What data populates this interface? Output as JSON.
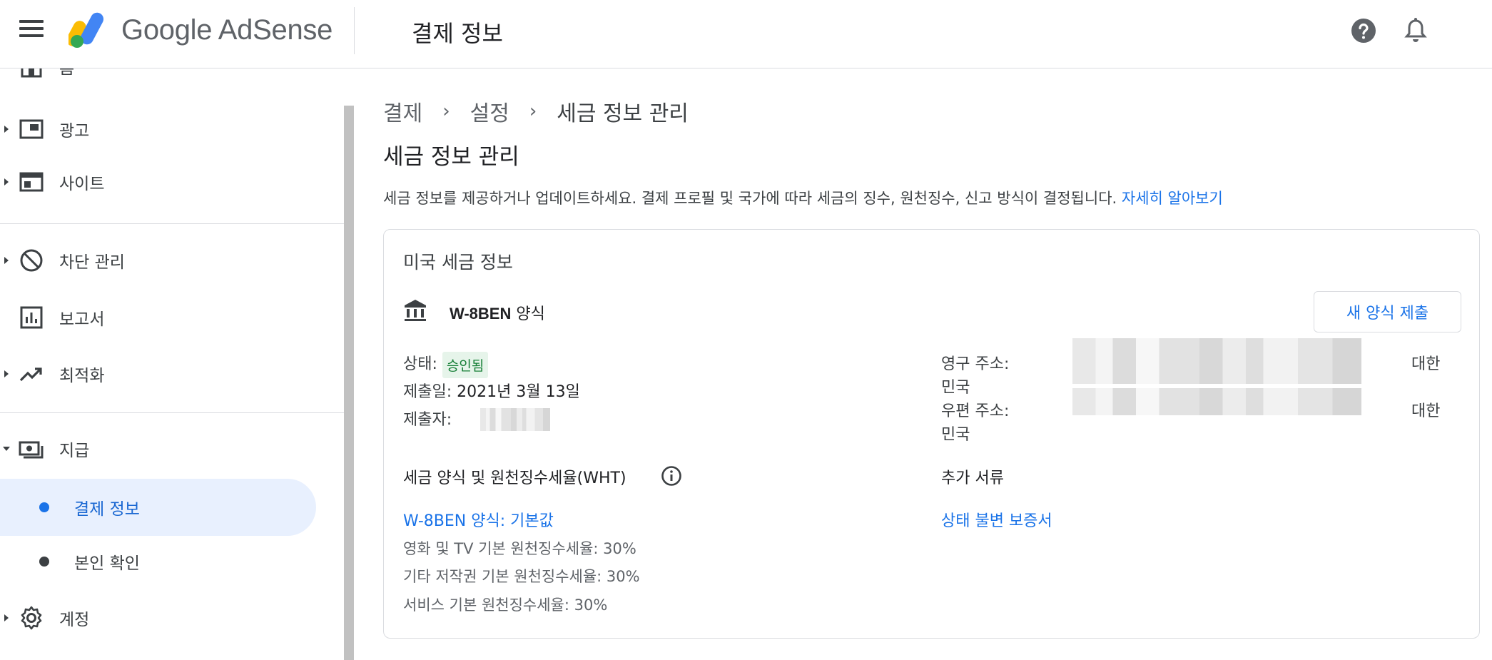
{
  "header": {
    "brand": "Google AdSense",
    "title": "결제 정보"
  },
  "sidebar": {
    "items": [
      {
        "label": "홈",
        "icon": "home-icon"
      },
      {
        "label": "광고",
        "icon": "ads-icon"
      },
      {
        "label": "사이트",
        "icon": "sites-icon"
      },
      {
        "label": "차단 관리",
        "icon": "block-icon"
      },
      {
        "label": "보고서",
        "icon": "reports-icon"
      },
      {
        "label": "최적화",
        "icon": "trending-icon"
      },
      {
        "label": "지급",
        "icon": "payments-icon"
      },
      {
        "label": "결제 정보",
        "icon": "dot"
      },
      {
        "label": "본인 확인",
        "icon": "dot"
      },
      {
        "label": "계정",
        "icon": "gear-icon"
      }
    ]
  },
  "breadcrumb": [
    "결제",
    "설정",
    "세금 정보 관리"
  ],
  "section": {
    "title": "세금 정보 관리",
    "description": "세금 정보를 제공하거나 업데이트하세요. 결제 프로필 및 국가에 따라 세금의 징수, 원천징수, 신고 방식이 결정됩니다.",
    "learn_more": "자세히 알아보기"
  },
  "card": {
    "title": "미국 세금 정보",
    "form_name_bold": "W-8BEN",
    "form_name_suffix": " 양식",
    "submit_button": "새 양식 제출",
    "status_label": "상태:",
    "status_value": "승인됨",
    "submitted_date_label": "제출일:",
    "submitted_date_value": "2021년 3월 13일",
    "submitter_label": "제출자:",
    "permanent_address_label": "영구 주소:",
    "permanent_address_country_1": "대한",
    "permanent_address_country_2": "민국",
    "mailing_address_label": "우편 주소:",
    "mailing_address_country_1": "대한",
    "mailing_address_country_2": "민국",
    "wht_label": "세금 양식 및 원천징수세율(WHT)",
    "additional_docs_label": "추가 서류",
    "form_link": "W-8BEN 양식: 기본값",
    "certificate_link": "상태 불변 보증서",
    "rates": [
      "영화 및 TV 기본 원천징수세율: 30%",
      "기타 저작권 기본 원천징수세율: 30%",
      "서비스 기본 원천징수세율: 30%"
    ]
  },
  "colors": {
    "accent": "#1a73e8",
    "active_bg": "#e8f0fe",
    "status_green": "#188038",
    "status_bg": "#e6f4ea"
  }
}
